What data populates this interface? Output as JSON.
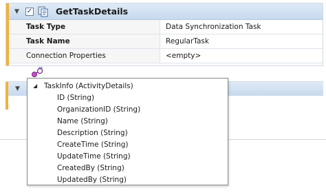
{
  "step": {
    "title": "GetTaskDetails",
    "checked": "✓",
    "collapse_glyph": "▼",
    "properties": [
      {
        "label": "Task Type",
        "value": "Data Synchronization Task"
      },
      {
        "label": "Task Name",
        "value": "RegularTask"
      },
      {
        "label": "Connection Properties",
        "value": "<empty>"
      }
    ]
  },
  "second_step": {
    "collapse_glyph": "▼"
  },
  "dropdown": {
    "root": {
      "label": "TaskInfo (ActivityDetails)",
      "toggle": "◢"
    },
    "fields": [
      "ID (String)",
      "OrganizationID (String)",
      "Name (String)",
      "Description (String)",
      "CreateTime (String)",
      "UpdateTime (String)",
      "CreatedBy (String)",
      "UpdatedBy (String)"
    ]
  },
  "colors": {
    "accent": "#f0b23a",
    "header_bg": "#c7d9ee",
    "border": "#cfd8e2"
  }
}
